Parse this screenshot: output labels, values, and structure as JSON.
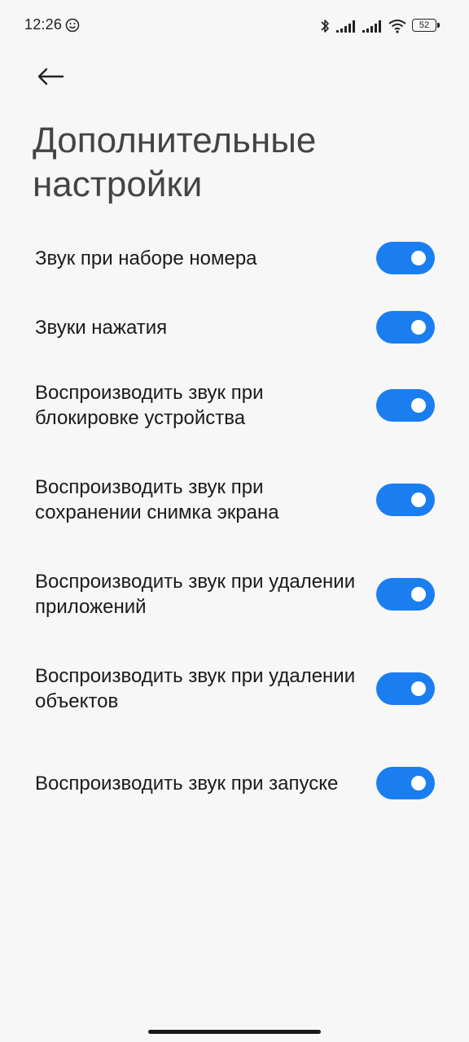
{
  "status_bar": {
    "time": "12:26",
    "battery_level": "52",
    "icons": [
      "emoji-notification-icon",
      "bluetooth-icon",
      "signal-icon",
      "signal-icon",
      "wifi-icon",
      "battery-icon"
    ]
  },
  "header": {
    "back_icon": "arrow-left-icon",
    "title": "Дополнительные настройки"
  },
  "settings": [
    {
      "label": "Звук при наборе номера",
      "enabled": true
    },
    {
      "label": "Звуки нажатия",
      "enabled": true
    },
    {
      "label": "Воспроизводить звук при блокировке устройства",
      "enabled": true
    },
    {
      "label": "Воспроизводить звук при сохранении снимка экрана",
      "enabled": true
    },
    {
      "label": "Воспроизводить звук при удалении приложений",
      "enabled": true
    },
    {
      "label": "Воспроизводить звук при удалении объектов",
      "enabled": true
    },
    {
      "label": "Воспроизводить звук при запуске",
      "enabled": true
    }
  ],
  "colors": {
    "accent": "#1a7ef0",
    "background": "#f7f7f7",
    "text": "#1a1a1a"
  }
}
